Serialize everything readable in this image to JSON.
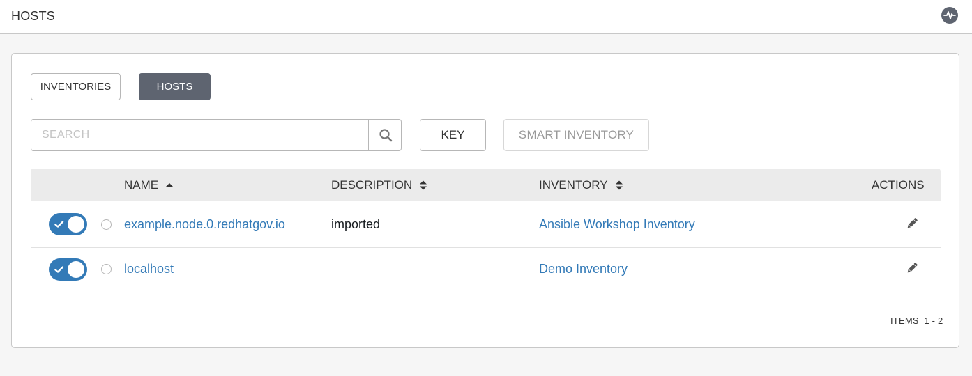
{
  "topbar": {
    "title": "HOSTS",
    "activity_icon": "activity-stream-icon"
  },
  "tabs": [
    {
      "label": "INVENTORIES",
      "active": false
    },
    {
      "label": "HOSTS",
      "active": true
    }
  ],
  "search": {
    "placeholder": "SEARCH",
    "value": "",
    "icon": "search-icon"
  },
  "toolbar": {
    "key_label": "KEY",
    "smart_inventory_label": "SMART INVENTORY"
  },
  "table": {
    "columns": [
      {
        "label": "NAME",
        "sort": "ascending"
      },
      {
        "label": "DESCRIPTION",
        "sort": "unsorted"
      },
      {
        "label": "INVENTORY",
        "sort": "unsorted"
      },
      {
        "label": "ACTIONS",
        "sort": "none"
      }
    ],
    "rows": [
      {
        "enabled": true,
        "name": "example.node.0.redhatgov.io",
        "description": "imported",
        "inventory": "Ansible Workshop Inventory"
      },
      {
        "enabled": true,
        "name": "localhost",
        "description": "",
        "inventory": "Demo Inventory"
      }
    ]
  },
  "pagination": {
    "label": "ITEMS",
    "range": "1 - 2"
  },
  "colors": {
    "accent": "#337ab7",
    "active_tab": "#5e6470",
    "header_bg": "#ebebeb"
  }
}
